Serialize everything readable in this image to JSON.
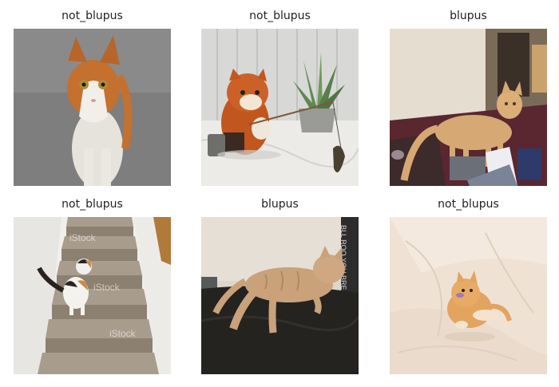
{
  "grid": {
    "items": [
      {
        "label": "not_blupus"
      },
      {
        "label": "not_blupus"
      },
      {
        "label": "blupus"
      },
      {
        "label": "not_blupus",
        "watermark": "iStock"
      },
      {
        "label": "blupus",
        "sign_text": "BLL ROO YOU BRE JOB STR"
      },
      {
        "label": "not_blupus"
      }
    ]
  }
}
